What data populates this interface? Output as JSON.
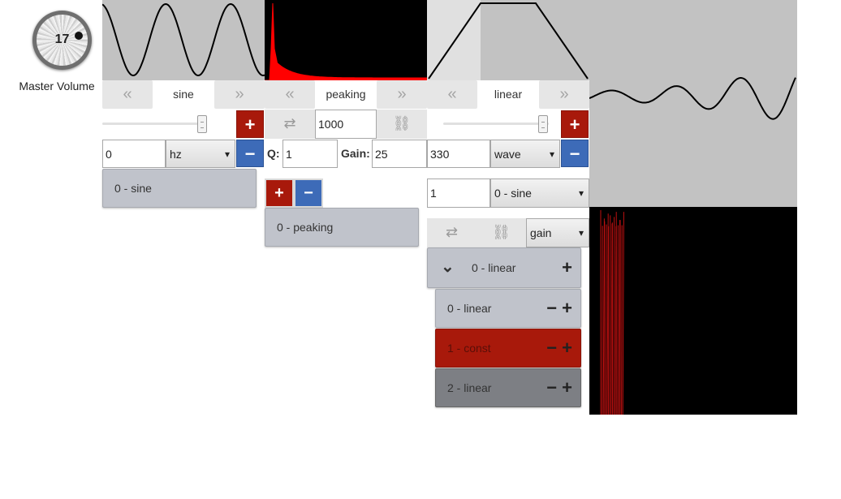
{
  "master": {
    "volume_value": "17",
    "label": "Master Volume"
  },
  "osc": {
    "nav_prev": "«",
    "type_label": "sine",
    "nav_next": "»",
    "plus": "+",
    "minus": "−",
    "freq_value": "0",
    "unit_select": "hz",
    "item": "0 - sine"
  },
  "filter": {
    "nav_prev": "«",
    "type_label": "peaking",
    "nav_next": "»",
    "swap_icon": "⇄",
    "freq_value": "1000",
    "unlink_icon": "⛓",
    "q_label": "Q:",
    "q_value": "1",
    "gain_label": "Gain:",
    "gain_value": "25",
    "plus": "+",
    "minus": "−",
    "item": "0 - peaking"
  },
  "env": {
    "nav_prev": "«",
    "type_label": "linear",
    "nav_next": "»",
    "plus": "+",
    "minus": "−",
    "value": "330",
    "wave_select": "wave",
    "count_value": "1",
    "source_select": "0 - sine",
    "swap_icon": "⇄",
    "unlink_icon": "⛓",
    "target_select": "gain",
    "tree": {
      "root": {
        "label": "0 - linear",
        "chevron": "⌄",
        "plus": "+"
      },
      "children": [
        {
          "label": "0 - linear",
          "minus": "−",
          "plus": "+"
        },
        {
          "label": "1 - const",
          "minus": "−",
          "plus": "+"
        },
        {
          "label": "2 - linear",
          "minus": "−",
          "plus": "+"
        }
      ]
    }
  },
  "colors": {
    "panel_grey": "#c2c2c2",
    "accent_red": "#a8190b",
    "accent_blue": "#3d6bb8",
    "spectrum_red": "#ff0000"
  }
}
